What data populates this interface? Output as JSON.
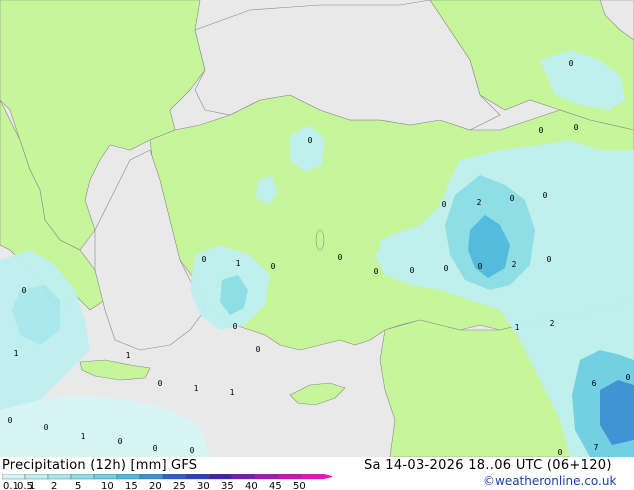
{
  "title": "Precipitation (12h) [mm] GFS",
  "valid_time": "Sa 14-03-2026 18..06 UTC (06+120)",
  "credit": "©weatheronline.co.uk",
  "legend": {
    "levels": [
      "0.1",
      "0.5",
      "1",
      "2",
      "5",
      "10",
      "15",
      "20",
      "25",
      "30",
      "35",
      "40",
      "45",
      "50"
    ],
    "colors": [
      "#d6f5f5",
      "#bff0f0",
      "#a6e8ee",
      "#8ddcea",
      "#6fcde6",
      "#4db9e0",
      "#3a8fd8",
      "#2b5fcf",
      "#2a3fbf",
      "#4020b0",
      "#7a1bb8",
      "#a816b8",
      "#d012b8",
      "#f010c0"
    ]
  },
  "colors": {
    "land": "#c6f59a",
    "sea": "#e9e9e9",
    "border": "#909090"
  },
  "value_labels": [
    "0",
    "0",
    "0",
    "0",
    "0",
    "0",
    "0",
    "2",
    "0",
    "0",
    "0",
    "1",
    "0",
    "0",
    "0",
    "0",
    "2",
    "1",
    "2",
    "0",
    "0",
    "1",
    "0",
    "1",
    "1",
    "6",
    "0",
    "0",
    "0",
    "0",
    "0",
    "0",
    "1",
    "0",
    "1",
    "0",
    "0",
    "7"
  ]
}
